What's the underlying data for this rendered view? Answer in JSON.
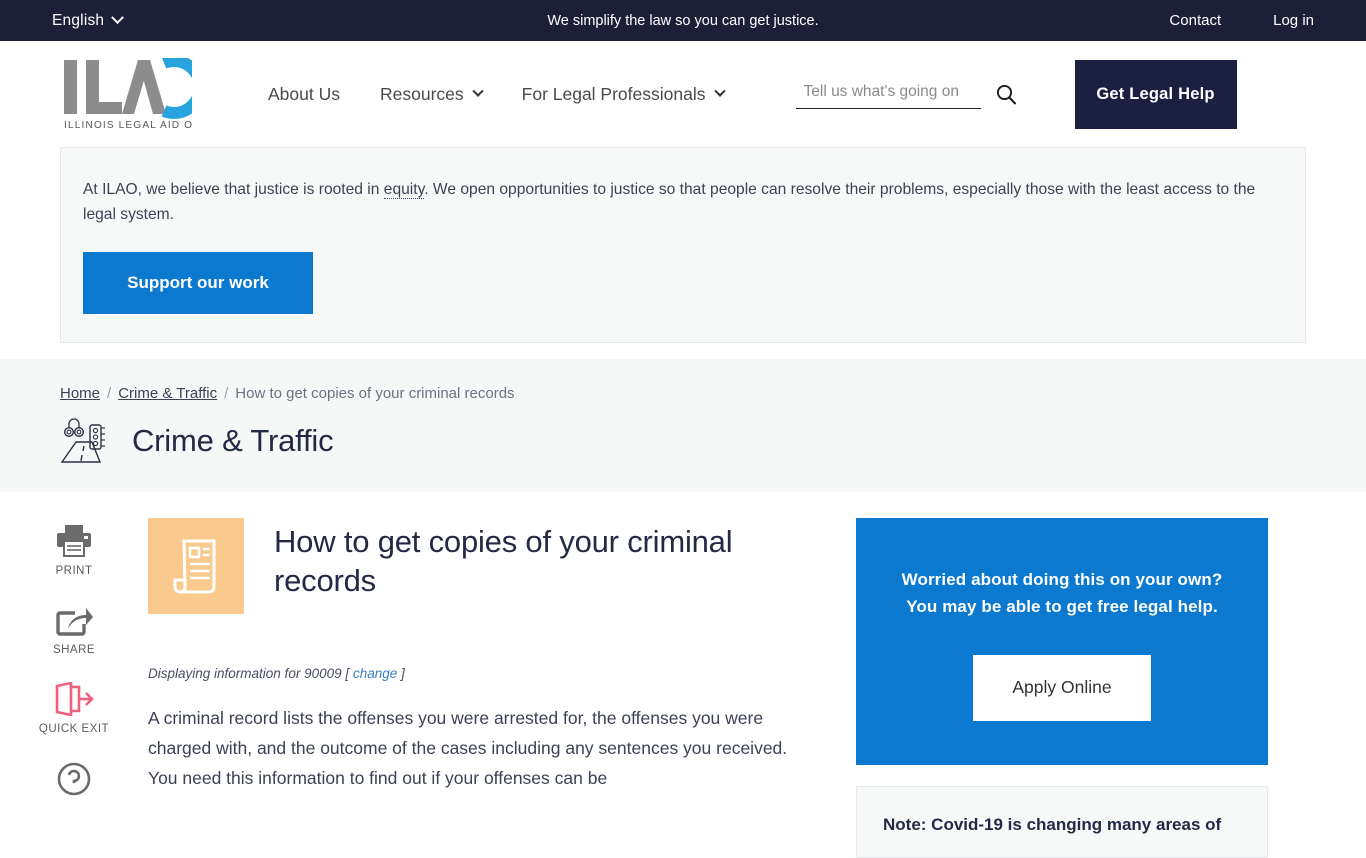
{
  "topbar": {
    "language": "English",
    "tagline": "We simplify the law so you can get justice.",
    "contact": "Contact",
    "login": "Log in"
  },
  "header": {
    "logo_text": "ILAO",
    "logo_subtitle": "ILLINOIS LEGAL AID ONLINE",
    "nav": [
      {
        "label": "About Us",
        "has_dropdown": false
      },
      {
        "label": "Resources",
        "has_dropdown": true
      },
      {
        "label": "For Legal Professionals",
        "has_dropdown": true
      }
    ],
    "search_placeholder": "Tell us what's going on",
    "search_value": "",
    "cta_label": "Get Legal Help"
  },
  "promo": {
    "text_before": "At ILAO, we believe that justice is rooted in ",
    "link_word": "equity",
    "text_after": ". We open opportunities to justice so that people can resolve their problems, especially those with the least access to the legal system.",
    "button_label": "Support our work",
    "button_color": "#0b79d0"
  },
  "breadcrumb": {
    "home": "Home",
    "category": "Crime & Traffic",
    "current": "How to get copies of your criminal records",
    "separator": "/"
  },
  "category": {
    "title": "Crime & Traffic",
    "icon": "traffic-road-icon"
  },
  "toolrail": [
    {
      "label": "PRINT",
      "icon": "print-icon",
      "color": "#6b6b6b"
    },
    {
      "label": "SHARE",
      "icon": "share-icon",
      "color": "#6b6b6b"
    },
    {
      "label": "QUICK EXIT",
      "icon": "quick-exit-icon",
      "color": "#f0607e"
    },
    {
      "label": "",
      "icon": "help-circle-icon",
      "color": "#6b6b6b"
    }
  ],
  "article": {
    "icon": "document-records-icon",
    "icon_bg": "#f9c98e",
    "title": "How to get copies of your criminal records",
    "zip_prefix": "Displaying information for",
    "zip_code": "90009",
    "zip_bracket_open": "[",
    "zip_change_label": "change",
    "zip_bracket_close": "]",
    "body": "A criminal record lists the offenses you were arrested for, the offenses you were charged with, and the outcome of the cases including any sentences you received. You need this information to find out if your offenses can be"
  },
  "help_card": {
    "line1": "Worried about doing this on your own?",
    "line2": "You may be able to get free legal help.",
    "button_label": "Apply Online",
    "bg_color": "#0b79d0"
  },
  "note_card": {
    "title": "Note: Covid-19 is changing many areas of"
  }
}
